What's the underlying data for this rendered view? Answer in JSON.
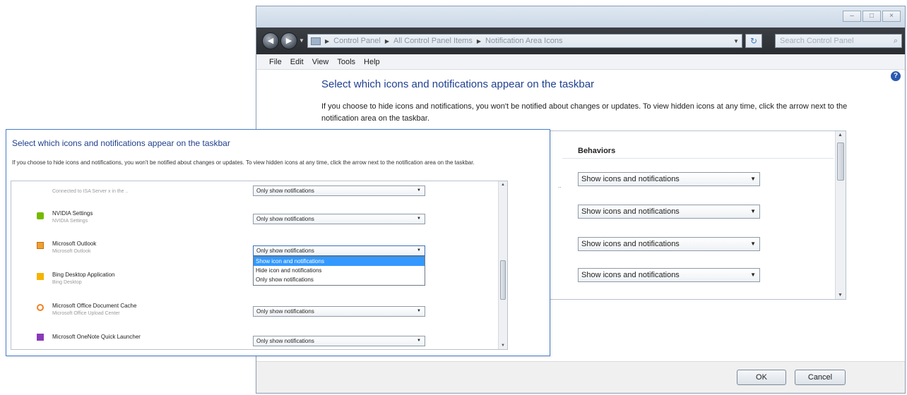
{
  "window": {
    "address": {
      "items": [
        "Control Panel",
        "All Control Panel Items",
        "Notification Area Icons"
      ]
    },
    "search_placeholder": "Search Control Panel",
    "menu": [
      "File",
      "Edit",
      "View",
      "Tools",
      "Help"
    ],
    "heading": "Select which icons and notifications appear on the taskbar",
    "description": "If you choose to hide icons and notifications, you won't be notified about changes or updates. To view hidden icons at any time, click the arrow next to the notification area on the taskbar.",
    "behaviors_header": "Behaviors",
    "behavior_values": [
      "Show icons and notifications",
      "Show icons and notifications",
      "Show icons and notifications",
      "Show icons and notifications"
    ],
    "ok_label": "OK",
    "cancel_label": "Cancel"
  },
  "zoom": {
    "heading": "Select which icons and notifications appear on the taskbar",
    "description": "If you choose to hide icons and notifications, you won't be notified about changes or updates. To view hidden icons at any time, click the arrow next to the notification area on the taskbar.",
    "top_partial_sub": "Connected to ISA Server x in the ..",
    "top_partial_value": "Only show notifications",
    "rows": [
      {
        "name": "NVIDIA Settings",
        "sub": "NVIDIA Settings",
        "value": "Only show notifications",
        "icon_color": "#76b900"
      },
      {
        "name": "Microsoft Outlook",
        "sub": "Microsoft Outlook",
        "value": "Only show notifications",
        "icon_color": "#f0a030"
      },
      {
        "name": "Bing Desktop Application",
        "sub": "Bing Desktop",
        "value": "",
        "icon_color": "#f4b400"
      },
      {
        "name": "Microsoft Office Document Cache",
        "sub": "Microsoft Office Upload Center",
        "value": "Only show notifications",
        "icon_color": "#f08020"
      },
      {
        "name": "Microsoft OneNote Quick Launcher",
        "sub": "",
        "value": "Only show notifications",
        "icon_color": "#8a3ab9"
      }
    ],
    "dropdown_options": [
      "Show icon and notifications",
      "Hide icon and notifications",
      "Only show notifications"
    ]
  },
  "colors": {
    "accent_blue": "#1f3f8f",
    "selection": "#3399ff",
    "zoom_border": "#4a7fd0"
  }
}
